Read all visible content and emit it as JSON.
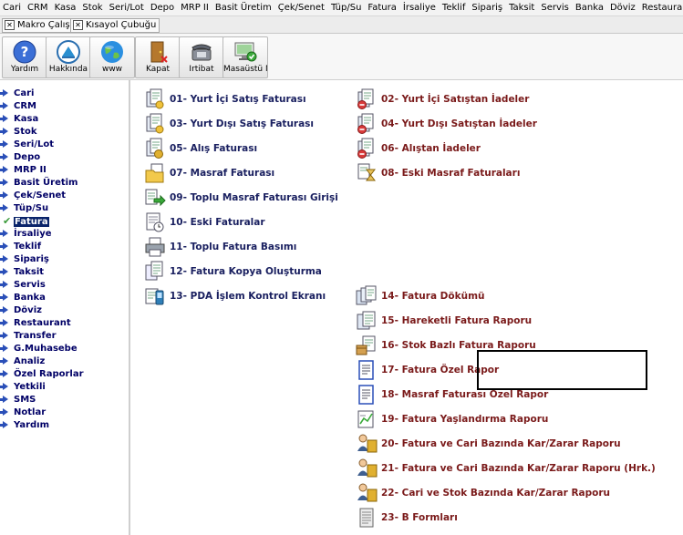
{
  "menubar": [
    "Cari",
    "CRM",
    "Kasa",
    "Stok",
    "Seri/Lot",
    "Depo",
    "MRP II",
    "Basit Üretim",
    "Çek/Senet",
    "Tüp/Su",
    "Fatura",
    "İrsaliye",
    "Teklif",
    "Sipariş",
    "Taksit",
    "Servis",
    "Banka",
    "Döviz",
    "Restaurant"
  ],
  "quicktabs": [
    "Makro Çalıştır",
    "Kısayol Çubuğu"
  ],
  "toolbar": [
    "Yardım",
    "Hakkında",
    "www",
    "Kapat",
    "İrtibat",
    "Masaüstü M"
  ],
  "leftnav": {
    "active_index": 10,
    "items": [
      "Cari",
      "CRM",
      "Kasa",
      "Stok",
      "Seri/Lot",
      "Depo",
      "MRP II",
      "Basit Üretim",
      "Çek/Senet",
      "Tüp/Su",
      "Fatura",
      "İrsaliye",
      "Teklif",
      "Sipariş",
      "Taksit",
      "Servis",
      "Banka",
      "Döviz",
      "Restaurant",
      "Transfer",
      "G.Muhasebe",
      "Analiz",
      "Özel Raporlar",
      "Yetkili",
      "SMS",
      "Notlar",
      "Yardım"
    ]
  },
  "left_column": [
    "01- Yurt İçi Satış Faturası",
    "03- Yurt Dışı Satış Faturası",
    "05- Alış Faturası",
    "07- Masraf Faturası",
    "09- Toplu Masraf Faturası Girişi",
    "10- Eski Faturalar",
    "11- Toplu Fatura Basımı",
    "12- Fatura Kopya Oluşturma",
    "13- PDA İşlem Kontrol Ekranı"
  ],
  "right_column": [
    "02- Yurt İçi Satıştan İadeler",
    "04- Yurt Dışı Satıştan İadeler",
    "06- Alıştan İadeler",
    "08- Eski Masraf Faturaları",
    "14- Fatura Dökümü",
    "15- Hareketli Fatura Raporu",
    "16- Stok Bazlı Fatura Raporu",
    "17- Fatura Özel Rapor",
    "18- Masraf Faturası Özel Rapor",
    "19- Fatura Yaşlandırma Raporu",
    "20- Fatura ve Cari Bazında Kar/Zarar Raporu",
    "21- Fatura ve Cari Bazında Kar/Zarar Raporu (Hrk.)",
    "22- Cari ve Stok Bazında Kar/Zarar Raporu",
    "23- B Formları"
  ],
  "colors": {
    "navy": "#1a2060",
    "maroon": "#7a1a1a",
    "highlight": "#000000"
  }
}
